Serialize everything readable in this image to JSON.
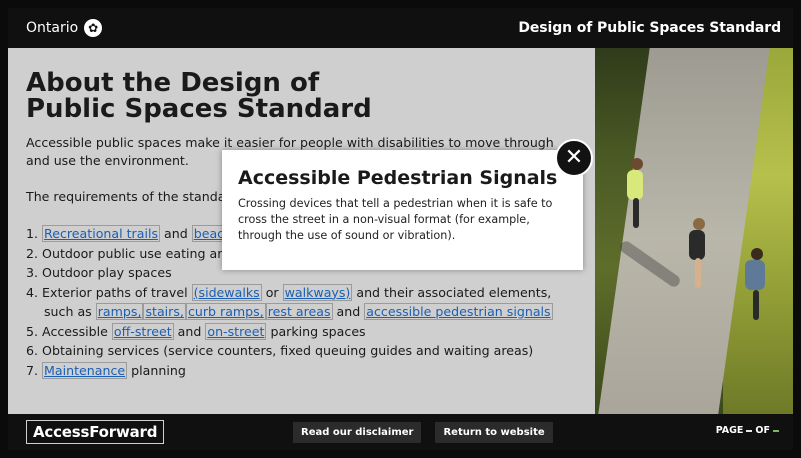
{
  "header": {
    "brand": "Ontario",
    "title": "Design of Public Spaces Standard"
  },
  "main": {
    "title": "About the Design of Public Spaces Standard",
    "intro_line1": "Accessible public spaces make it easier for people with disabilities to move through",
    "intro_line2": "and use the environment.",
    "req_intro": "The requirements of the standard",
    "items": [
      {
        "num": "1.",
        "link1": "Recreational trails",
        "mid": " and ",
        "link2": "beach access routes"
      },
      {
        "num": "2.",
        "text": "Outdoor public use eating areas"
      },
      {
        "num": "3.",
        "text": "Outdoor play spaces"
      },
      {
        "num": "4.",
        "pre": "Exterior paths of travel ",
        "link1": "(sidewalks",
        "mid": " or ",
        "link2": "walkways)",
        "post": " and their associated elements,"
      },
      {
        "pre": "such as ",
        "l1": "ramps,",
        "l2": "stairs,",
        "l3": "curb ramps,",
        "l4": "rest areas",
        "and": " and ",
        "l5": "accessible pedestrian signals"
      },
      {
        "num": "5.",
        "pre": "Accessible ",
        "link1": "off-street",
        "mid": " and ",
        "link2": "on-street",
        "post": " parking spaces"
      },
      {
        "num": "6.",
        "text": "Obtaining services (service counters, fixed queuing guides and waiting areas)"
      },
      {
        "num": "7.",
        "link1": "Maintenance",
        "post": " planning"
      }
    ]
  },
  "popup": {
    "title": "Accessible Pedestrian Signals",
    "body": "Crossing devices that tell a pedestrian when it is safe to cross the street in a non-visual format (for example, through the use of sound or vibration).",
    "close_icon": "close-icon"
  },
  "footer": {
    "logo": "AccessForward",
    "disclaimer_label": "Read our disclaimer",
    "return_label": "Return to website",
    "page_label": "PAGE",
    "current_page": "",
    "of_label": "OF",
    "total_pages": ""
  },
  "colors": {
    "link": "#1a5fb4",
    "content_bg": "#cfcfcf",
    "bar_bg": "#101010",
    "page_total_bg": "#7bb661"
  }
}
